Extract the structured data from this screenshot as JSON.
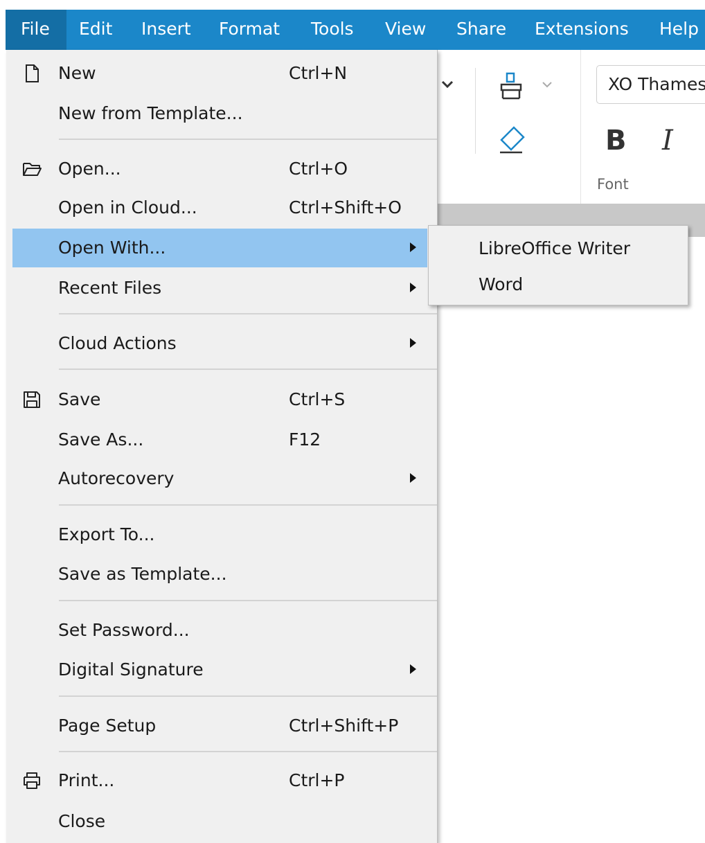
{
  "menubar": {
    "items": [
      "File",
      "Edit",
      "Insert",
      "Format",
      "Tools",
      "View",
      "Share",
      "Extensions",
      "Help"
    ],
    "active": "File",
    "color": "#1b87c9"
  },
  "toolbar": {
    "font_name": "XO Thames",
    "group_label": "Font",
    "bold_label": "B",
    "italic_label": "I"
  },
  "file_menu": {
    "new": {
      "label": "New",
      "shortcut": "Ctrl+N",
      "icon": "new-document-icon"
    },
    "new_from_template": {
      "label": "New from Template..."
    },
    "open": {
      "label": "Open...",
      "shortcut": "Ctrl+O",
      "icon": "folder-open-icon"
    },
    "open_in_cloud": {
      "label": "Open in Cloud...",
      "shortcut": "Ctrl+Shift+O"
    },
    "open_with": {
      "label": "Open With..."
    },
    "recent_files": {
      "label": "Recent Files"
    },
    "cloud_actions": {
      "label": "Cloud Actions"
    },
    "save": {
      "label": "Save",
      "shortcut": "Ctrl+S",
      "icon": "floppy-disk-icon"
    },
    "save_as": {
      "label": "Save As...",
      "shortcut": "F12"
    },
    "autorecovery": {
      "label": "Autorecovery"
    },
    "export_to": {
      "label": "Export To..."
    },
    "save_as_template": {
      "label": "Save as Template..."
    },
    "set_password": {
      "label": "Set Password..."
    },
    "digital_signature": {
      "label": "Digital Signature"
    },
    "page_setup": {
      "label": "Page Setup",
      "shortcut": "Ctrl+Shift+P"
    },
    "print": {
      "label": "Print...",
      "shortcut": "Ctrl+P",
      "icon": "printer-icon"
    },
    "close": {
      "label": "Close"
    },
    "highlight_color": "#92c5f0"
  },
  "open_with_submenu": {
    "items": [
      "LibreOffice Writer",
      "Word"
    ]
  }
}
